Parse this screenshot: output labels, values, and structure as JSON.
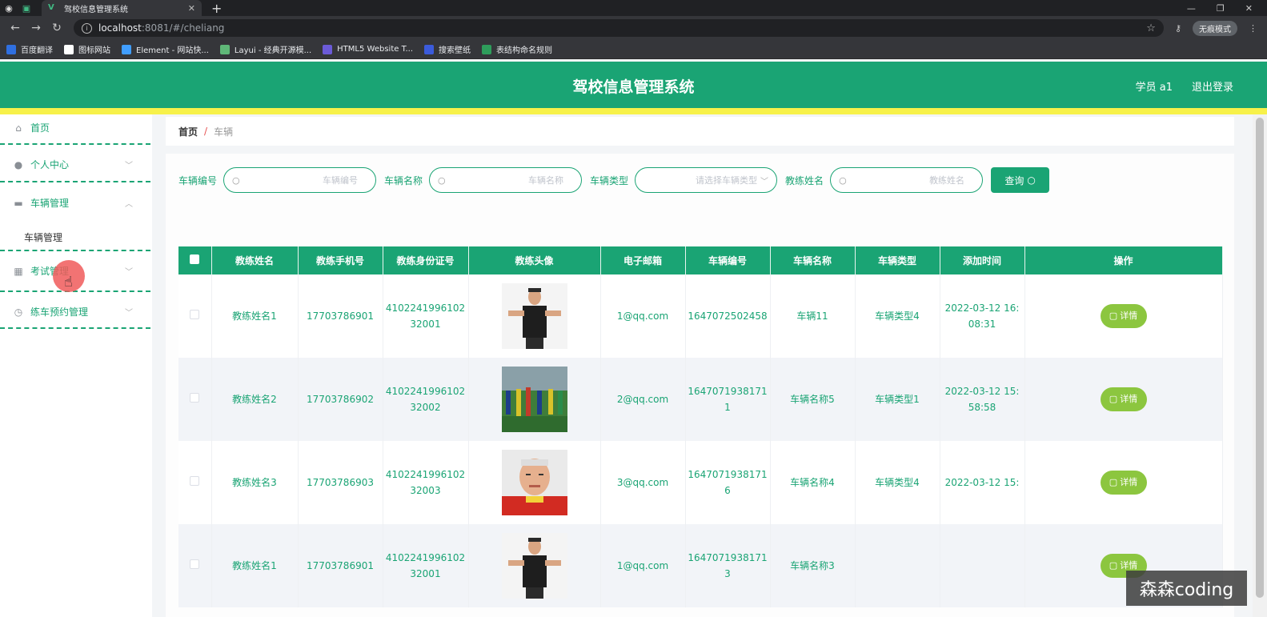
{
  "browser": {
    "tab_title": "驾校信息管理系统",
    "url_host": "localhost",
    "url_path": ":8081/#/cheliang",
    "incognito_label": "无痕模式",
    "bookmarks": [
      {
        "label": "百度翻译",
        "color": "#2f6fe0"
      },
      {
        "label": "图标网站",
        "color": "#ffffff"
      },
      {
        "label": "Element - 网站快...",
        "color": "#409eff"
      },
      {
        "label": "Layui - 经典开源模...",
        "color": "#5fb878"
      },
      {
        "label": "HTML5 Website T...",
        "color": "#6b5bd8"
      },
      {
        "label": "搜索壁纸",
        "color": "#3b5bdb"
      },
      {
        "label": "表结构命名规则",
        "color": "#2e9d5b"
      }
    ]
  },
  "header": {
    "title": "驾校信息管理系统",
    "user": "学员 a1",
    "logout": "退出登录"
  },
  "sidebar": {
    "items": [
      {
        "label": "首页",
        "icon": "home-icon"
      },
      {
        "label": "个人中心",
        "icon": "user-icon"
      },
      {
        "label": "车辆管理",
        "icon": "briefcase-icon"
      },
      {
        "label": "考试管理",
        "icon": "grid-icon"
      },
      {
        "label": "练车预约管理",
        "icon": "clock-icon"
      }
    ],
    "submenu_label": "车辆管理"
  },
  "breadcrumb": {
    "home": "首页",
    "separator": "/",
    "current": "车辆"
  },
  "search": {
    "fields": [
      {
        "label": "车辆编号",
        "placeholder": "车辆编号"
      },
      {
        "label": "车辆名称",
        "placeholder": "车辆名称"
      },
      {
        "label": "车辆类型",
        "placeholder": "请选择车辆类型"
      },
      {
        "label": "教练姓名",
        "placeholder": "教练姓名"
      }
    ],
    "button": "查询"
  },
  "table": {
    "headers": [
      "教练姓名",
      "教练手机号",
      "教练身份证号",
      "教练头像",
      "电子邮箱",
      "车辆编号",
      "车辆名称",
      "车辆类型",
      "添加时间",
      "操作"
    ],
    "detail_label": "详情",
    "rows": [
      {
        "name": "教练姓名1",
        "phone": "17703786901",
        "id_line1": "4102241996102",
        "id_line2": "32001",
        "avatar": "coach-man-black-shirt",
        "email": "1@qq.com",
        "vehicle_no_line1": "1647072502458",
        "vehicle_no_line2": "",
        "vehicle_name": "车辆11",
        "vehicle_type": "车辆类型4",
        "time_line1": "2022-03-12 16:",
        "time_line2": "08:31"
      },
      {
        "name": "教练姓名2",
        "phone": "17703786902",
        "id_line1": "4102241996102",
        "id_line2": "32002",
        "avatar": "training-field",
        "email": "2@qq.com",
        "vehicle_no_line1": "1647071938171",
        "vehicle_no_line2": "1",
        "vehicle_name": "车辆名称5",
        "vehicle_type": "车辆类型1",
        "time_line1": "2022-03-12 15:",
        "time_line2": "58:58"
      },
      {
        "name": "教练姓名3",
        "phone": "17703786903",
        "id_line1": "4102241996102",
        "id_line2": "32003",
        "avatar": "coach-older-man",
        "email": "3@qq.com",
        "vehicle_no_line1": "1647071938171",
        "vehicle_no_line2": "6",
        "vehicle_name": "车辆名称4",
        "vehicle_type": "车辆类型4",
        "time_line1": "2022-03-12 15:",
        "time_line2": ""
      },
      {
        "name": "教练姓名1",
        "phone": "17703786901",
        "id_line1": "4102241996102",
        "id_line2": "32001",
        "avatar": "coach-man-black-shirt",
        "email": "1@qq.com",
        "vehicle_no_line1": "1647071938171",
        "vehicle_no_line2": "3",
        "vehicle_name": "车辆名称3",
        "vehicle_type": "",
        "time_line1": "",
        "time_line2": ""
      }
    ]
  },
  "watermark": "森森coding",
  "colors": {
    "primary": "#1aa474",
    "accent_yellow": "#f7f14a",
    "detail_button": "#8cc63f"
  }
}
